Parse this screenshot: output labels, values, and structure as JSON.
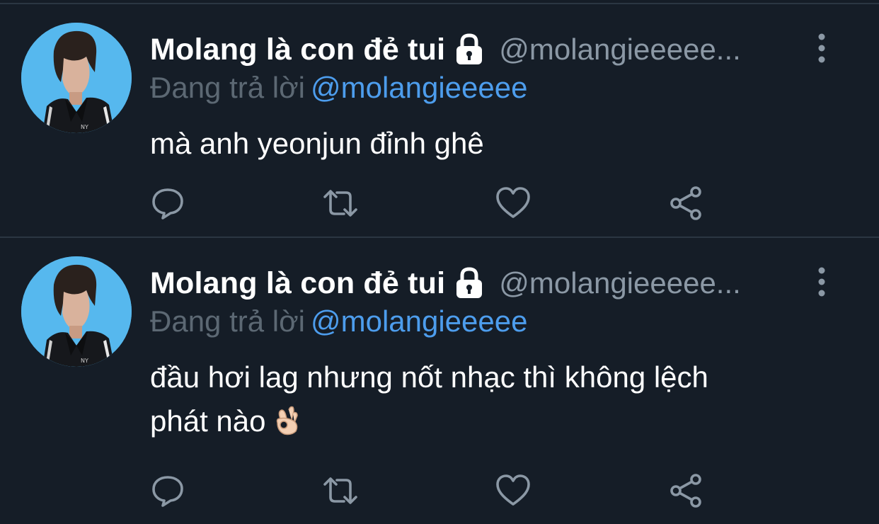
{
  "tweets": [
    {
      "display_name": "Molang là con đẻ tui",
      "handle": "@molangieeeee...",
      "reply_label": "Đang trả lời",
      "reply_to": "@molangieeeee",
      "text_lines": [
        "mà anh yeonjun đỉnh ghê"
      ],
      "icons": {
        "lock": "lock-icon",
        "more": "more-vertical-icon",
        "reply": "reply-icon",
        "retweet": "retweet-icon",
        "like": "heart-icon",
        "share": "share-icon"
      }
    },
    {
      "display_name": "Molang là con đẻ tui",
      "handle": "@molangieeeee...",
      "reply_label": "Đang trả lời",
      "reply_to": "@molangieeeee",
      "text_lines": [
        "đầu hơi lag nhưng nốt nhạc thì không lệch",
        "phát nào"
      ],
      "emoji": "ok-hand-emoji",
      "icons": {
        "lock": "lock-icon",
        "more": "more-vertical-icon",
        "reply": "reply-icon",
        "retweet": "retweet-icon",
        "like": "heart-icon",
        "share": "share-icon"
      }
    }
  ],
  "colors": {
    "background": "#151d27",
    "divider": "#2b3642",
    "text": "#ffffff",
    "muted": "#8b98a5",
    "link": "#4d9ded",
    "icon": "#8b98a5",
    "avatar_bg": "#56b8ee"
  }
}
